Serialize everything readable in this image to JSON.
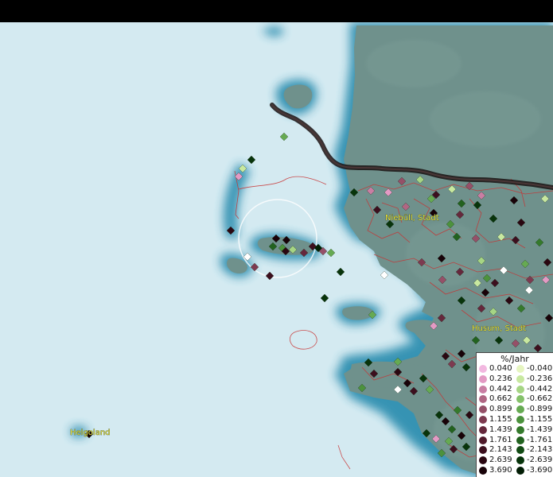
{
  "place_labels": {
    "niebuell": "Niebüll, Stadt",
    "husum": "Husum, Stadt",
    "helgoland": "Helgoland"
  },
  "legend": {
    "title": "%/Jahr",
    "positive": [
      {
        "label": "0.040",
        "color": "#f2b8e0"
      },
      {
        "label": "0.236",
        "color": "#e39ac4"
      },
      {
        "label": "0.442",
        "color": "#c97ea3"
      },
      {
        "label": "0.662",
        "color": "#b06683"
      },
      {
        "label": "0.899",
        "color": "#955068"
      },
      {
        "label": "1.155",
        "color": "#7d3a50"
      },
      {
        "label": "1.439",
        "color": "#65283c"
      },
      {
        "label": "1.761",
        "color": "#501a2b"
      },
      {
        "label": "2.143",
        "color": "#3c0f1e"
      },
      {
        "label": "2.639",
        "color": "#2a0711"
      },
      {
        "label": "3.690",
        "color": "#180208"
      }
    ],
    "negative": [
      {
        "label": "-0.040",
        "color": "#e6f5c0"
      },
      {
        "label": "-0.236",
        "color": "#c8e8a0"
      },
      {
        "label": "-0.442",
        "color": "#a6d584"
      },
      {
        "label": "-0.662",
        "color": "#85c16a"
      },
      {
        "label": "-0.899",
        "color": "#66aa52"
      },
      {
        "label": "-1.155",
        "color": "#4c923d"
      },
      {
        "label": "-1.439",
        "color": "#357a2c"
      },
      {
        "label": "-1.761",
        "color": "#22621f"
      },
      {
        "label": "-2.143",
        "color": "#134b14"
      },
      {
        "label": "-2.639",
        "color": "#08340b"
      },
      {
        "label": "-3.690",
        "color": "#021d05"
      }
    ]
  },
  "colors": {
    "sea": "#d4eaf1",
    "coast_halo": "#2f8fb0",
    "land": "#6f918c",
    "border_line": "#c83232",
    "national_border": "#1a1212",
    "place_text": "#e8e23a"
  }
}
